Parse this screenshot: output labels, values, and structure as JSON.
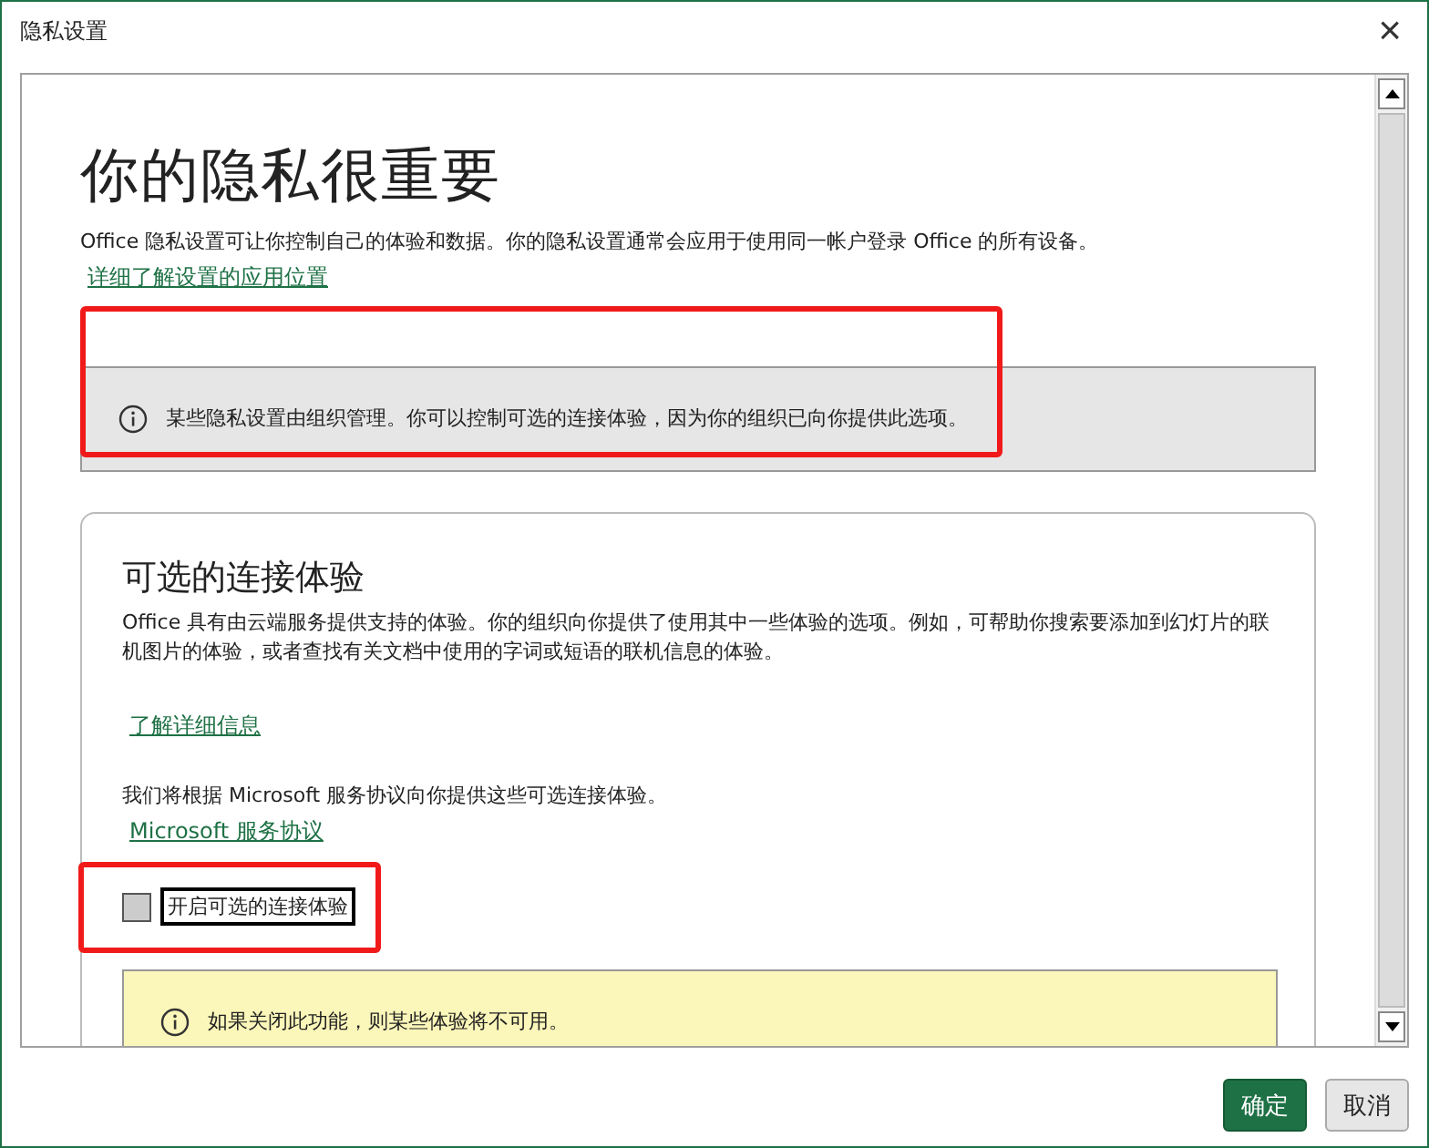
{
  "window": {
    "title": "隐私设置",
    "close": "×"
  },
  "heading": "你的隐私很重要",
  "intro": "Office 隐私设置可让你控制自己的体验和数据。你的隐私设置通常会应用于使用同一帐户登录 Office 的所有设备。",
  "intro_link": "详细了解设置的应用位置",
  "org_notice": {
    "text": "某些隐私设置由组织管理。你可以控制可选的连接体验，因为你的组织已向你提供此选项。",
    "highlighted": true
  },
  "section": {
    "title": "可选的连接体验",
    "description": "Office 具有由云端服务提供支持的体验。你的组织向你提供了使用其中一些体验的选项。例如，可帮助你搜索要添加到幻灯片的联机图片的体验，或者查找有关文档中使用的字词或短语的联机信息的体验。",
    "learn_link": "了解详细信息",
    "agreement_text": "我们将根据 Microsoft 服务协议向你提供这些可选连接体验。",
    "agreement_link": "Microsoft 服务协议",
    "checkbox": {
      "label": "开启可选的连接体验",
      "checked": false,
      "focused": true,
      "highlighted": true
    },
    "warning": "如果关闭此功能，则某些体验将不可用。"
  },
  "buttons": [
    {
      "label": "确定",
      "kind": "primary"
    },
    {
      "label": "取消",
      "kind": "secondary"
    }
  ]
}
